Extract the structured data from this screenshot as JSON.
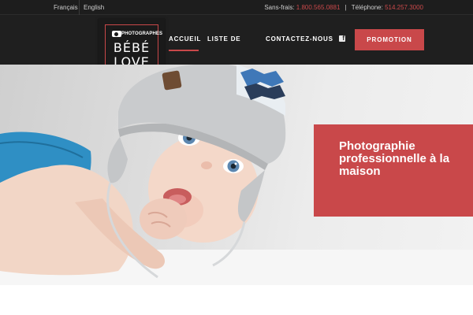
{
  "languages": {
    "french": "Français",
    "english": "English"
  },
  "contact": {
    "tollfree_label": "Sans-frais:",
    "tollfree_number": "1.800.565.0881",
    "separator": "|",
    "phone_label": "Téléphone:",
    "phone_number": "514.257.3000"
  },
  "logo": {
    "tagline": "PHOTOGRAPHES",
    "line1": "BÉBÉ",
    "line2": "LOVE"
  },
  "nav": {
    "items": [
      {
        "label": "ACCUEIL",
        "active": true
      },
      {
        "label": "LISTE DE"
      },
      {
        "label": "CONTACTEZ-NOUS"
      }
    ],
    "social_icon": "facebook-icon",
    "promo_label": "PROMOTION"
  },
  "hero": {
    "title": "Photographie professionnelle à la maison"
  },
  "colors": {
    "accent": "#c9484a",
    "dark": "#1f1f1f",
    "topbar": "#1d1d1d"
  }
}
